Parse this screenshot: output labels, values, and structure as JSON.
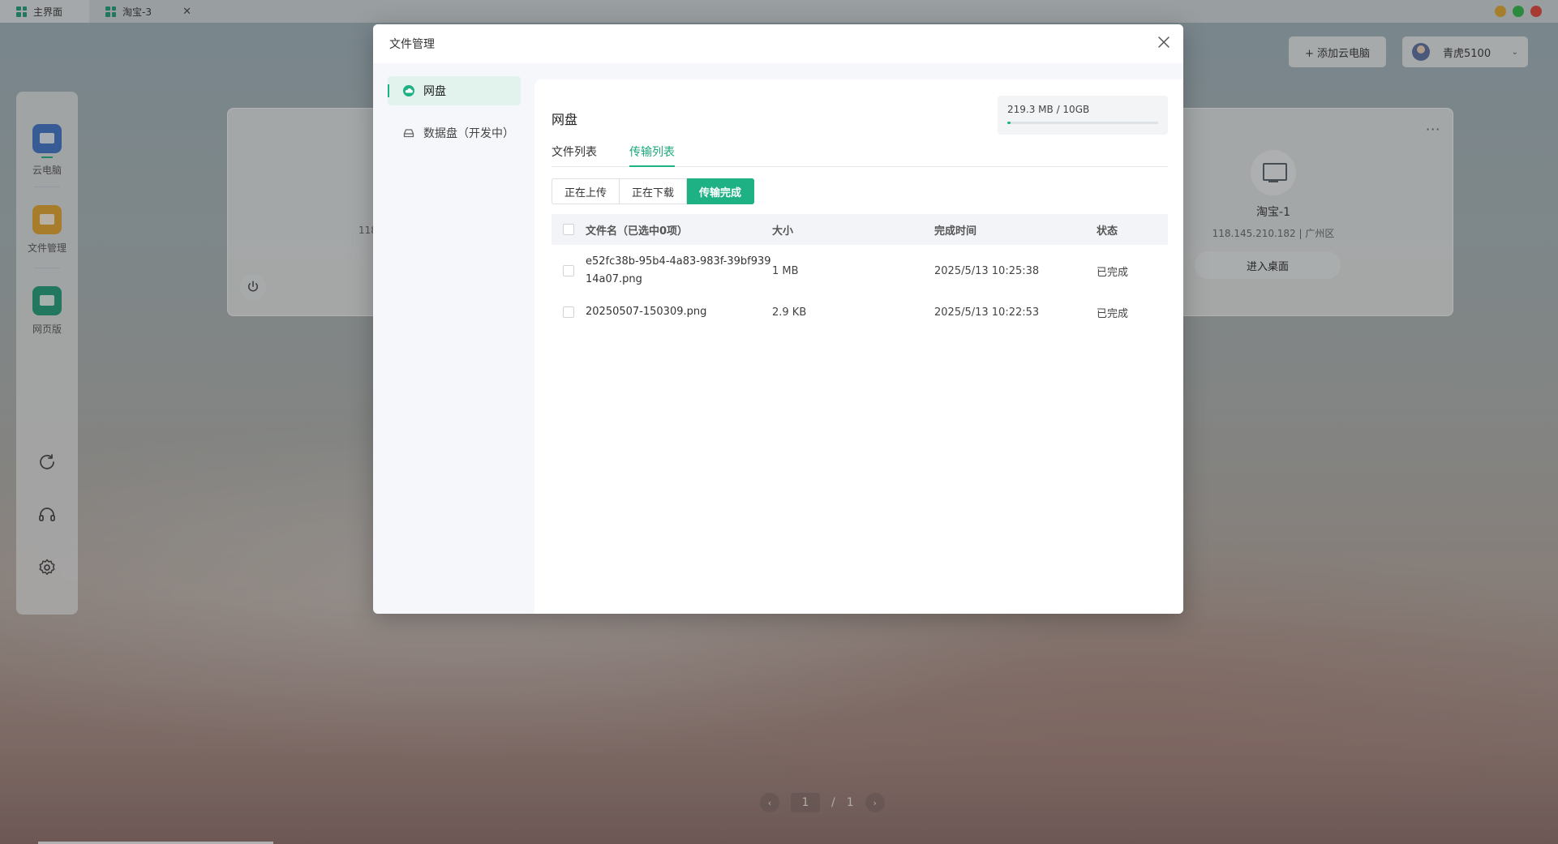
{
  "tabs": [
    {
      "label": "主界面"
    },
    {
      "label": "淘宝-3"
    }
  ],
  "window_controls": {
    "colors": [
      "#e0a82e",
      "#2fb84a",
      "#e4443a"
    ]
  },
  "header": {
    "add_pc_label": "+ 添加云电脑",
    "user_name": "青虎5100"
  },
  "sidebar": {
    "items": [
      {
        "label": "云电脑",
        "icon": "monitor-icon",
        "color": "#3f74c9"
      },
      {
        "label": "文件管理",
        "icon": "folder-icon",
        "color": "#e3a62f"
      },
      {
        "label": "网页版",
        "icon": "browser-icon",
        "color": "#1f9d7a"
      }
    ],
    "tools": [
      "refresh-icon",
      "headset-icon",
      "settings-icon"
    ]
  },
  "background_card": {
    "partial_ip": "118",
    "name": "淘宝-1",
    "ip": "118.145.210.182 | 广州区",
    "enter_label": "进入桌面",
    "more": "···"
  },
  "pager": {
    "current": "1",
    "separator": "/",
    "total": "1"
  },
  "modal": {
    "title": "文件管理",
    "nav": [
      {
        "label": "网盘",
        "icon": "cloud-icon",
        "active": true
      },
      {
        "label": "数据盘（开发中）",
        "icon": "disk-icon",
        "active": false
      }
    ],
    "panel_title": "网盘",
    "quota": {
      "text": "219.3 MB / 10GB",
      "fraction": 0.021
    },
    "tabs": [
      {
        "label": "文件列表",
        "active": false
      },
      {
        "label": "传输列表",
        "active": true
      }
    ],
    "segments": [
      {
        "label": "正在上传",
        "active": false
      },
      {
        "label": "正在下载",
        "active": false
      },
      {
        "label": "传输完成",
        "active": true
      }
    ],
    "table": {
      "headers": [
        "文件名（已选中0项）",
        "大小",
        "完成时间",
        "状态"
      ],
      "rows": [
        {
          "name": "e52fc38b-95b4-4a83-983f-39bf93914a07.png",
          "size": "1 MB",
          "time": "2025/5/13 10:25:38",
          "status": "已完成"
        },
        {
          "name": "20250507-150309.png",
          "size": "2.9 KB",
          "time": "2025/5/13 10:22:53",
          "status": "已完成"
        }
      ]
    }
  },
  "accent_color": "#1db184"
}
